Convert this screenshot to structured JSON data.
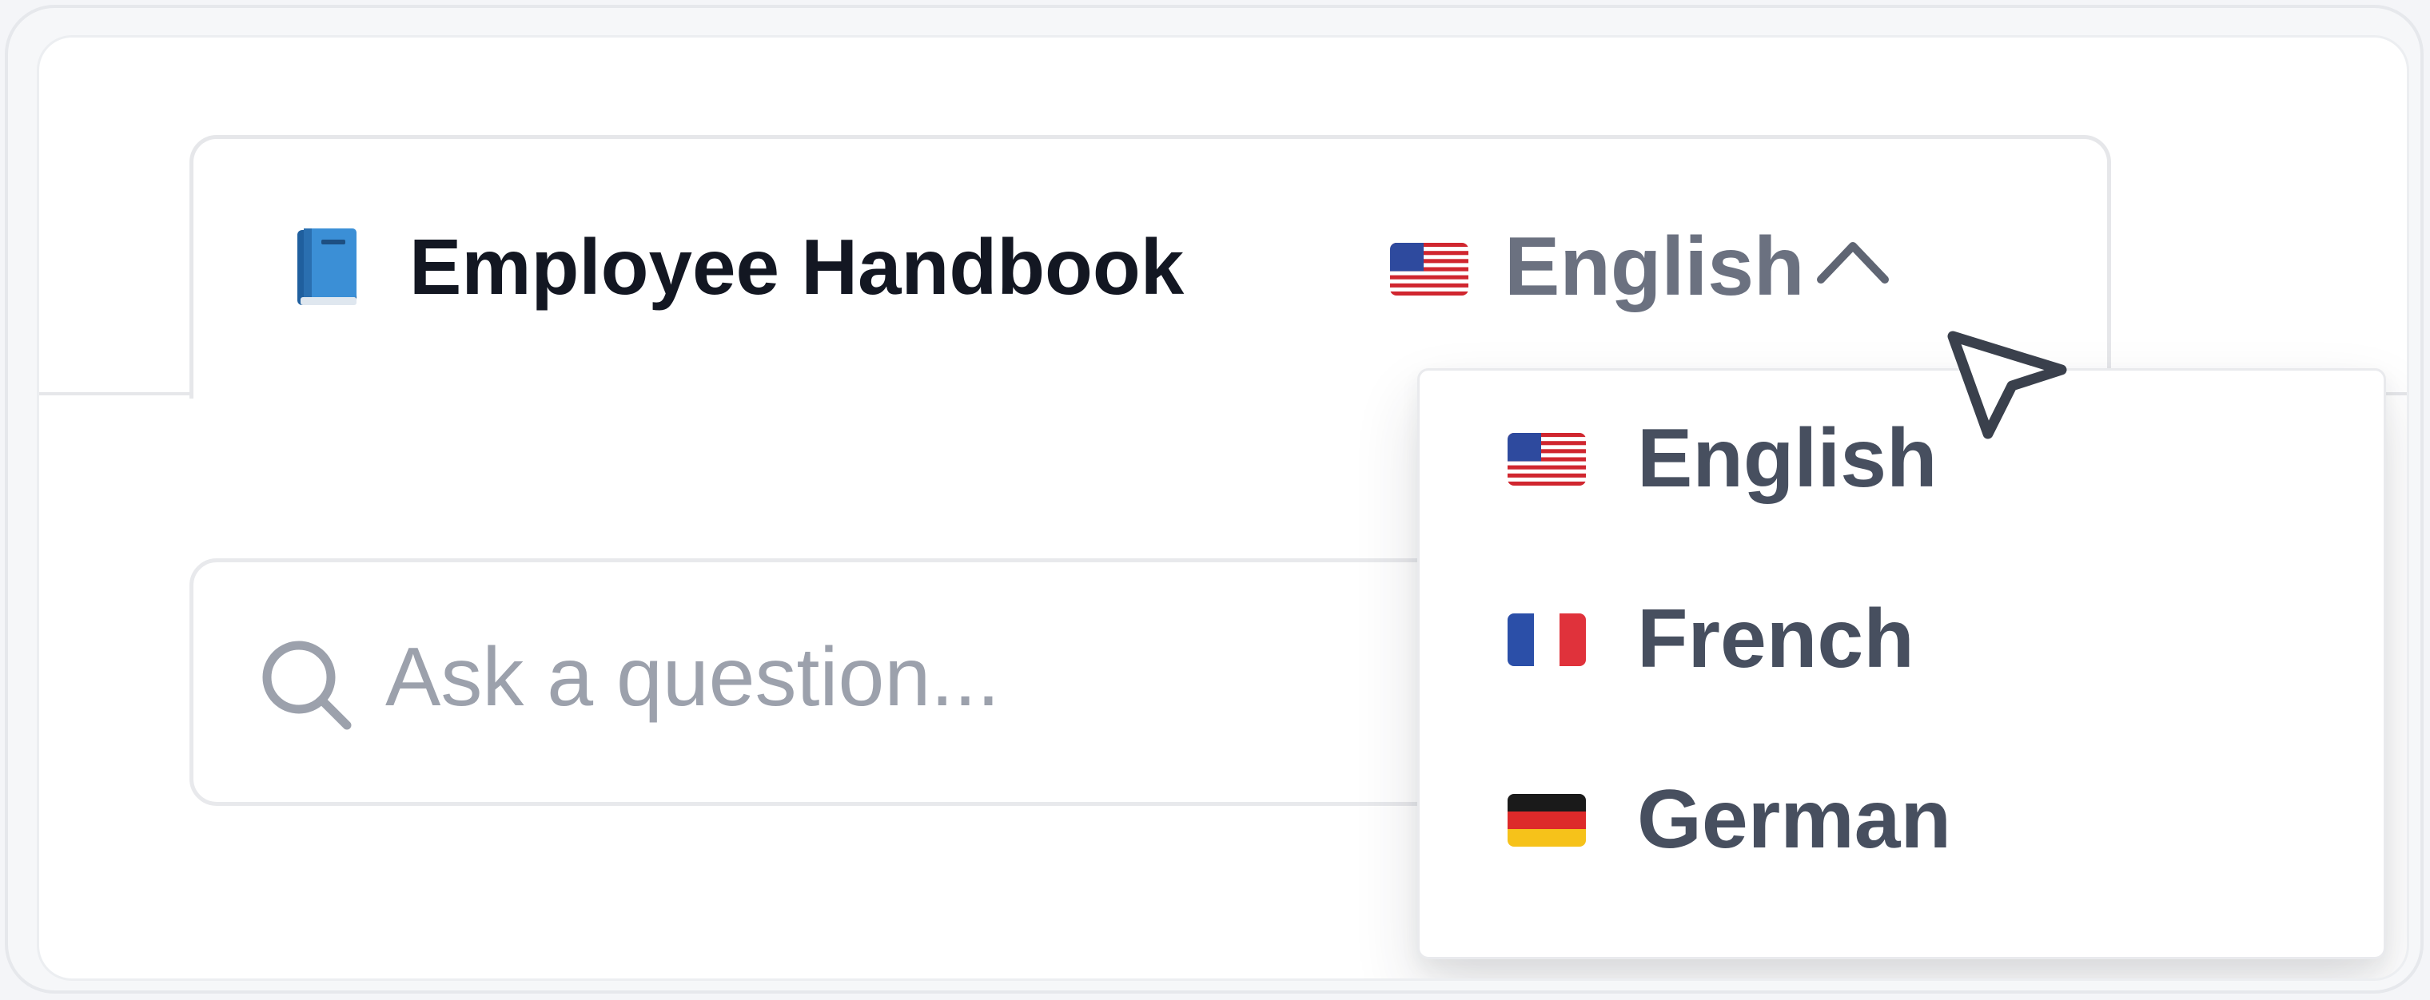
{
  "header": {
    "icon": "blue-book-icon",
    "title": "Employee Handbook"
  },
  "language_selector": {
    "selected_flag": "us-flag-icon",
    "selected": "English",
    "state": "open"
  },
  "search": {
    "icon": "search-icon",
    "placeholder": "Ask a question..."
  },
  "language_menu": {
    "options": [
      {
        "label": "English",
        "flag": "us-flag-icon"
      },
      {
        "label": "French",
        "flag": "france-flag-icon"
      },
      {
        "label": "German",
        "flag": "germany-flag-icon"
      }
    ]
  },
  "colors": {
    "title_text": "#131722",
    "muted_text": "#6b7180",
    "menu_text": "#474f5f",
    "placeholder_text": "#9ca1ac",
    "border": "#e6e7ea",
    "book_blue": "#2f80c9"
  }
}
